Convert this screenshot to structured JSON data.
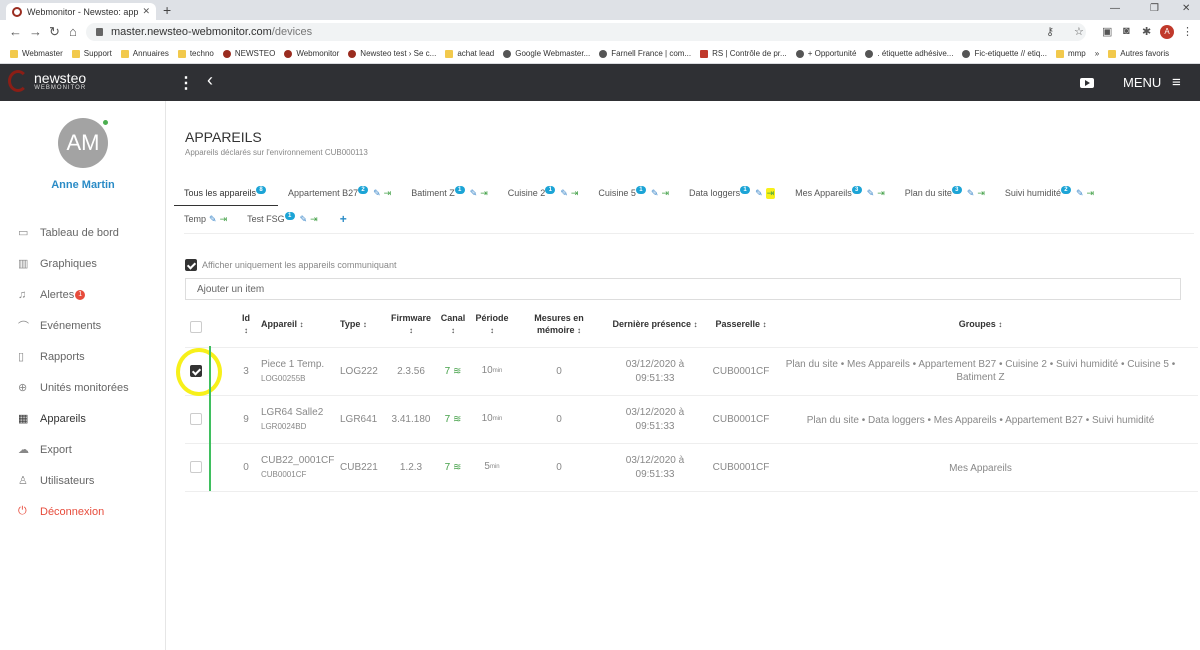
{
  "browser": {
    "tab_title": "Webmonitor - Newsteo: applicati",
    "url_domain": "master.newsteo-webmonitor.com",
    "url_path": "/devices",
    "profile_initial": "A",
    "bookmarks": [
      {
        "label": "Webmaster",
        "icon": "folder"
      },
      {
        "label": "Support",
        "icon": "folder"
      },
      {
        "label": "Annuaires",
        "icon": "folder"
      },
      {
        "label": "techno",
        "icon": "folder"
      },
      {
        "label": "NEWSTEO",
        "icon": "newsteo"
      },
      {
        "label": "Webmonitor",
        "icon": "newsteo"
      },
      {
        "label": "Newsteo test › Se c...",
        "icon": "newsteo"
      },
      {
        "label": "achat lead",
        "icon": "folder"
      },
      {
        "label": "Google Webmaster...",
        "icon": "round"
      },
      {
        "label": "Farnell France | com...",
        "icon": "round"
      },
      {
        "label": "RS | Contrôle de pr...",
        "icon": "red"
      },
      {
        "label": "+ Opportunité",
        "icon": "round"
      },
      {
        "label": ". étiquette adhésive...",
        "icon": "round"
      },
      {
        "label": "Fic-etiquette // etiq...",
        "icon": "round"
      },
      {
        "label": "mmp",
        "icon": "folder"
      },
      {
        "label": "»",
        "icon": "none"
      },
      {
        "label": "Autres favoris",
        "icon": "folder"
      }
    ]
  },
  "header": {
    "logo_text": "newsteo",
    "logo_sub": "WEBMONITOR",
    "menu_label": "MENU"
  },
  "sidebar": {
    "avatar_initials": "AM",
    "user_name": "Anne Martin",
    "items": [
      {
        "label": "Tableau de bord",
        "icon": "monitor-icon"
      },
      {
        "label": "Graphiques",
        "icon": "chart-icon"
      },
      {
        "label": "Alertes",
        "icon": "bell-icon",
        "badge": "1"
      },
      {
        "label": "Evénements",
        "icon": "paperclip-icon"
      },
      {
        "label": "Rapports",
        "icon": "document-icon"
      },
      {
        "label": "Unités monitorées",
        "icon": "target-icon"
      },
      {
        "label": "Appareils",
        "icon": "grid-icon",
        "active": true
      },
      {
        "label": "Export",
        "icon": "cloud-icon"
      },
      {
        "label": "Utilisateurs",
        "icon": "user-icon"
      },
      {
        "label": "Déconnexion",
        "icon": "power-icon"
      }
    ]
  },
  "page": {
    "title": "APPAREILS",
    "subtitle": "Appareils déclarés sur l'environnement CUB000113",
    "tabs": [
      {
        "label": "Tous les appareils",
        "badge": "8"
      },
      {
        "label": "Appartement B27",
        "badge": "2"
      },
      {
        "label": "Batiment Z",
        "badge": "1"
      },
      {
        "label": "Cuisine 2",
        "badge": "1"
      },
      {
        "label": "Cuisine 5",
        "badge": "1"
      },
      {
        "label": "Data loggers",
        "badge": "1"
      },
      {
        "label": "Mes Appareils",
        "badge": "3"
      },
      {
        "label": "Plan du site",
        "badge": "3"
      },
      {
        "label": "Suivi humidité",
        "badge": "2"
      },
      {
        "label": "Temp",
        "badge": ""
      },
      {
        "label": "Test FSG",
        "badge": "1"
      }
    ],
    "filter_label": "Afficher uniquement les appareils communiquant",
    "add_placeholder": "Ajouter un item"
  },
  "table": {
    "headers": {
      "id": "Id",
      "device": "Appareil",
      "type": "Type",
      "firmware": "Firmware",
      "channel": "Canal",
      "period": "Période",
      "memory": "Mesures en mémoire",
      "last_seen": "Dernière présence",
      "gateway": "Passerelle",
      "groups": "Groupes"
    },
    "rows": [
      {
        "checked": true,
        "id": "3",
        "name": "Piece 1 Temp.",
        "serial": "LOG00255B",
        "type": "LOG222",
        "firmware": "2.3.56",
        "channel": "7",
        "period": "10",
        "period_unit": "min",
        "memory": "0",
        "date": "03/12/2020 à",
        "time": "09:51:33",
        "gateway": "CUB0001CF",
        "groups": "Plan du site • Mes Appareils • Appartement B27 • Cuisine 2 • Suivi humidité • Cuisine 5 • Batiment Z"
      },
      {
        "checked": false,
        "id": "9",
        "name": "LGR64 Salle2",
        "serial": "LGR0024BD",
        "type": "LGR641",
        "firmware": "3.41.180",
        "channel": "7",
        "period": "10",
        "period_unit": "min",
        "memory": "0",
        "date": "03/12/2020 à",
        "time": "09:51:33",
        "gateway": "CUB0001CF",
        "groups": "Plan du site • Data loggers • Mes Appareils • Appartement B27 • Suivi humidité"
      },
      {
        "checked": false,
        "id": "0",
        "name": "CUB22_0001CF",
        "serial": "CUB0001CF",
        "type": "CUB221",
        "firmware": "1.2.3",
        "channel": "7",
        "period": "5",
        "period_unit": "min",
        "memory": "0",
        "date": "03/12/2020 à",
        "time": "09:51:33",
        "gateway": "CUB0001CF",
        "groups": "Mes Appareils"
      }
    ]
  },
  "colors": {
    "header_bg": "#2f3034",
    "accent": "#1ca4d6",
    "link": "#2a8bc6",
    "highlight": "#f7f01a",
    "annotation_line": "#3fbf5f",
    "danger": "#e74c3c"
  }
}
